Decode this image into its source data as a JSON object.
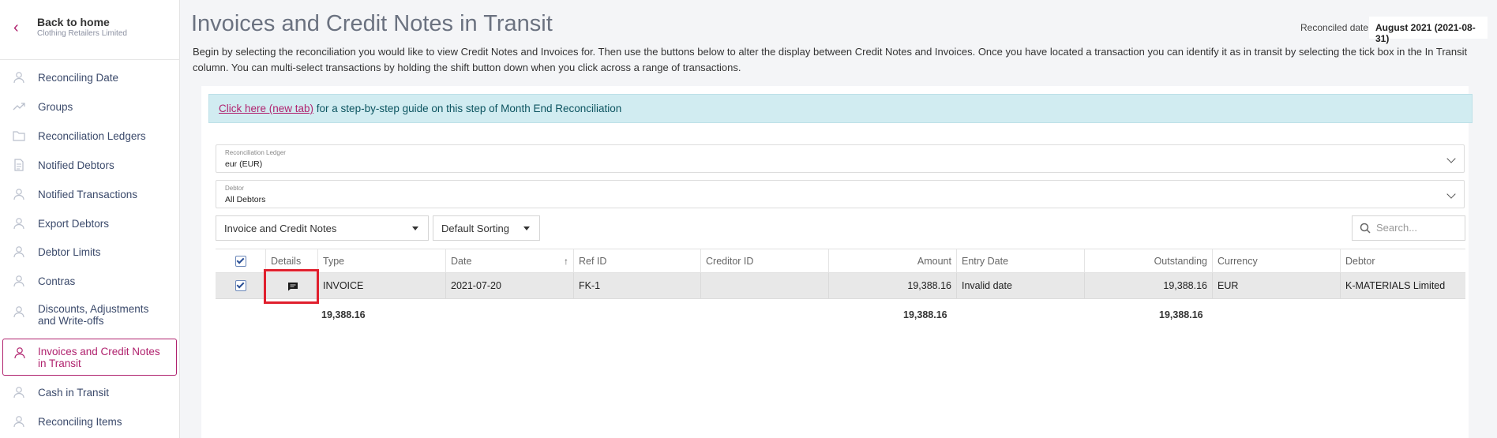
{
  "sidebar": {
    "back": {
      "title": "Back to home",
      "subtitle": "Clothing Retailers Limited"
    },
    "items": [
      {
        "label": "Reconciling Date",
        "icon": "user-icon"
      },
      {
        "label": "Groups",
        "icon": "trend-icon"
      },
      {
        "label": "Reconciliation Ledgers",
        "icon": "folder-icon"
      },
      {
        "label": "Notified Debtors",
        "icon": "document-icon"
      },
      {
        "label": "Notified Transactions",
        "icon": "user-icon"
      },
      {
        "label": "Export Debtors",
        "icon": "user-icon"
      },
      {
        "label": "Debtor Limits",
        "icon": "user-icon"
      },
      {
        "label": "Contras",
        "icon": "user-icon"
      },
      {
        "label": "Discounts, Adjustments\nand Write-offs",
        "icon": "user-icon"
      },
      {
        "label": "Invoices and Credit Notes\nin Transit",
        "icon": "user-icon",
        "active": true
      },
      {
        "label": "Cash in Transit",
        "icon": "user-icon"
      },
      {
        "label": "Reconciling Items",
        "icon": "user-icon"
      }
    ]
  },
  "header": {
    "title": "Invoices and Credit Notes in Transit",
    "reconciled_label": "Reconciled date",
    "reconciled_value": "August 2021 (2021-08-31)",
    "intro": "Begin by selecting the reconciliation you would like to view Credit Notes and Invoices for. Then use the buttons below to alter the display between Credit Notes and Invoices. Once you have located a transaction you can identify it as in transit by selecting the tick box in the In Transit column. You can multi-select transactions by holding the shift button down when you click across a range of transactions."
  },
  "info": {
    "link": "Click here (new tab)",
    "text": " for a step-by-step guide on this step of Month End Reconciliation"
  },
  "filters": {
    "ledger_label": "Reconciliation Ledger",
    "ledger_value": "eur (EUR)",
    "debtor_label": "Debtor",
    "debtor_value": "All Debtors",
    "type_value": "Invoice and Credit Notes",
    "sort_value": "Default Sorting",
    "search_placeholder": "Search..."
  },
  "table": {
    "columns": [
      "Details",
      "Type",
      "Date",
      "Ref ID",
      "Creditor ID",
      "Amount",
      "Entry Date",
      "Outstanding",
      "Currency",
      "Debtor"
    ],
    "rows": [
      {
        "selected": true,
        "details_icon": "comment-icon",
        "type": "INVOICE",
        "date": "2021-07-20",
        "ref_id": "FK-1",
        "creditor_id": "",
        "amount": "19,388.16",
        "entry_date": "Invalid date",
        "outstanding": "19,388.16",
        "currency": "EUR",
        "debtor": "K-MATERIALS Limited"
      }
    ],
    "totals": {
      "type": "19,388.16",
      "amount": "19,388.16",
      "outstanding": "19,388.16"
    }
  },
  "colors": {
    "accent": "#b0226e",
    "info_bg": "#d1ecf1",
    "highlight": "#e01f2d"
  }
}
